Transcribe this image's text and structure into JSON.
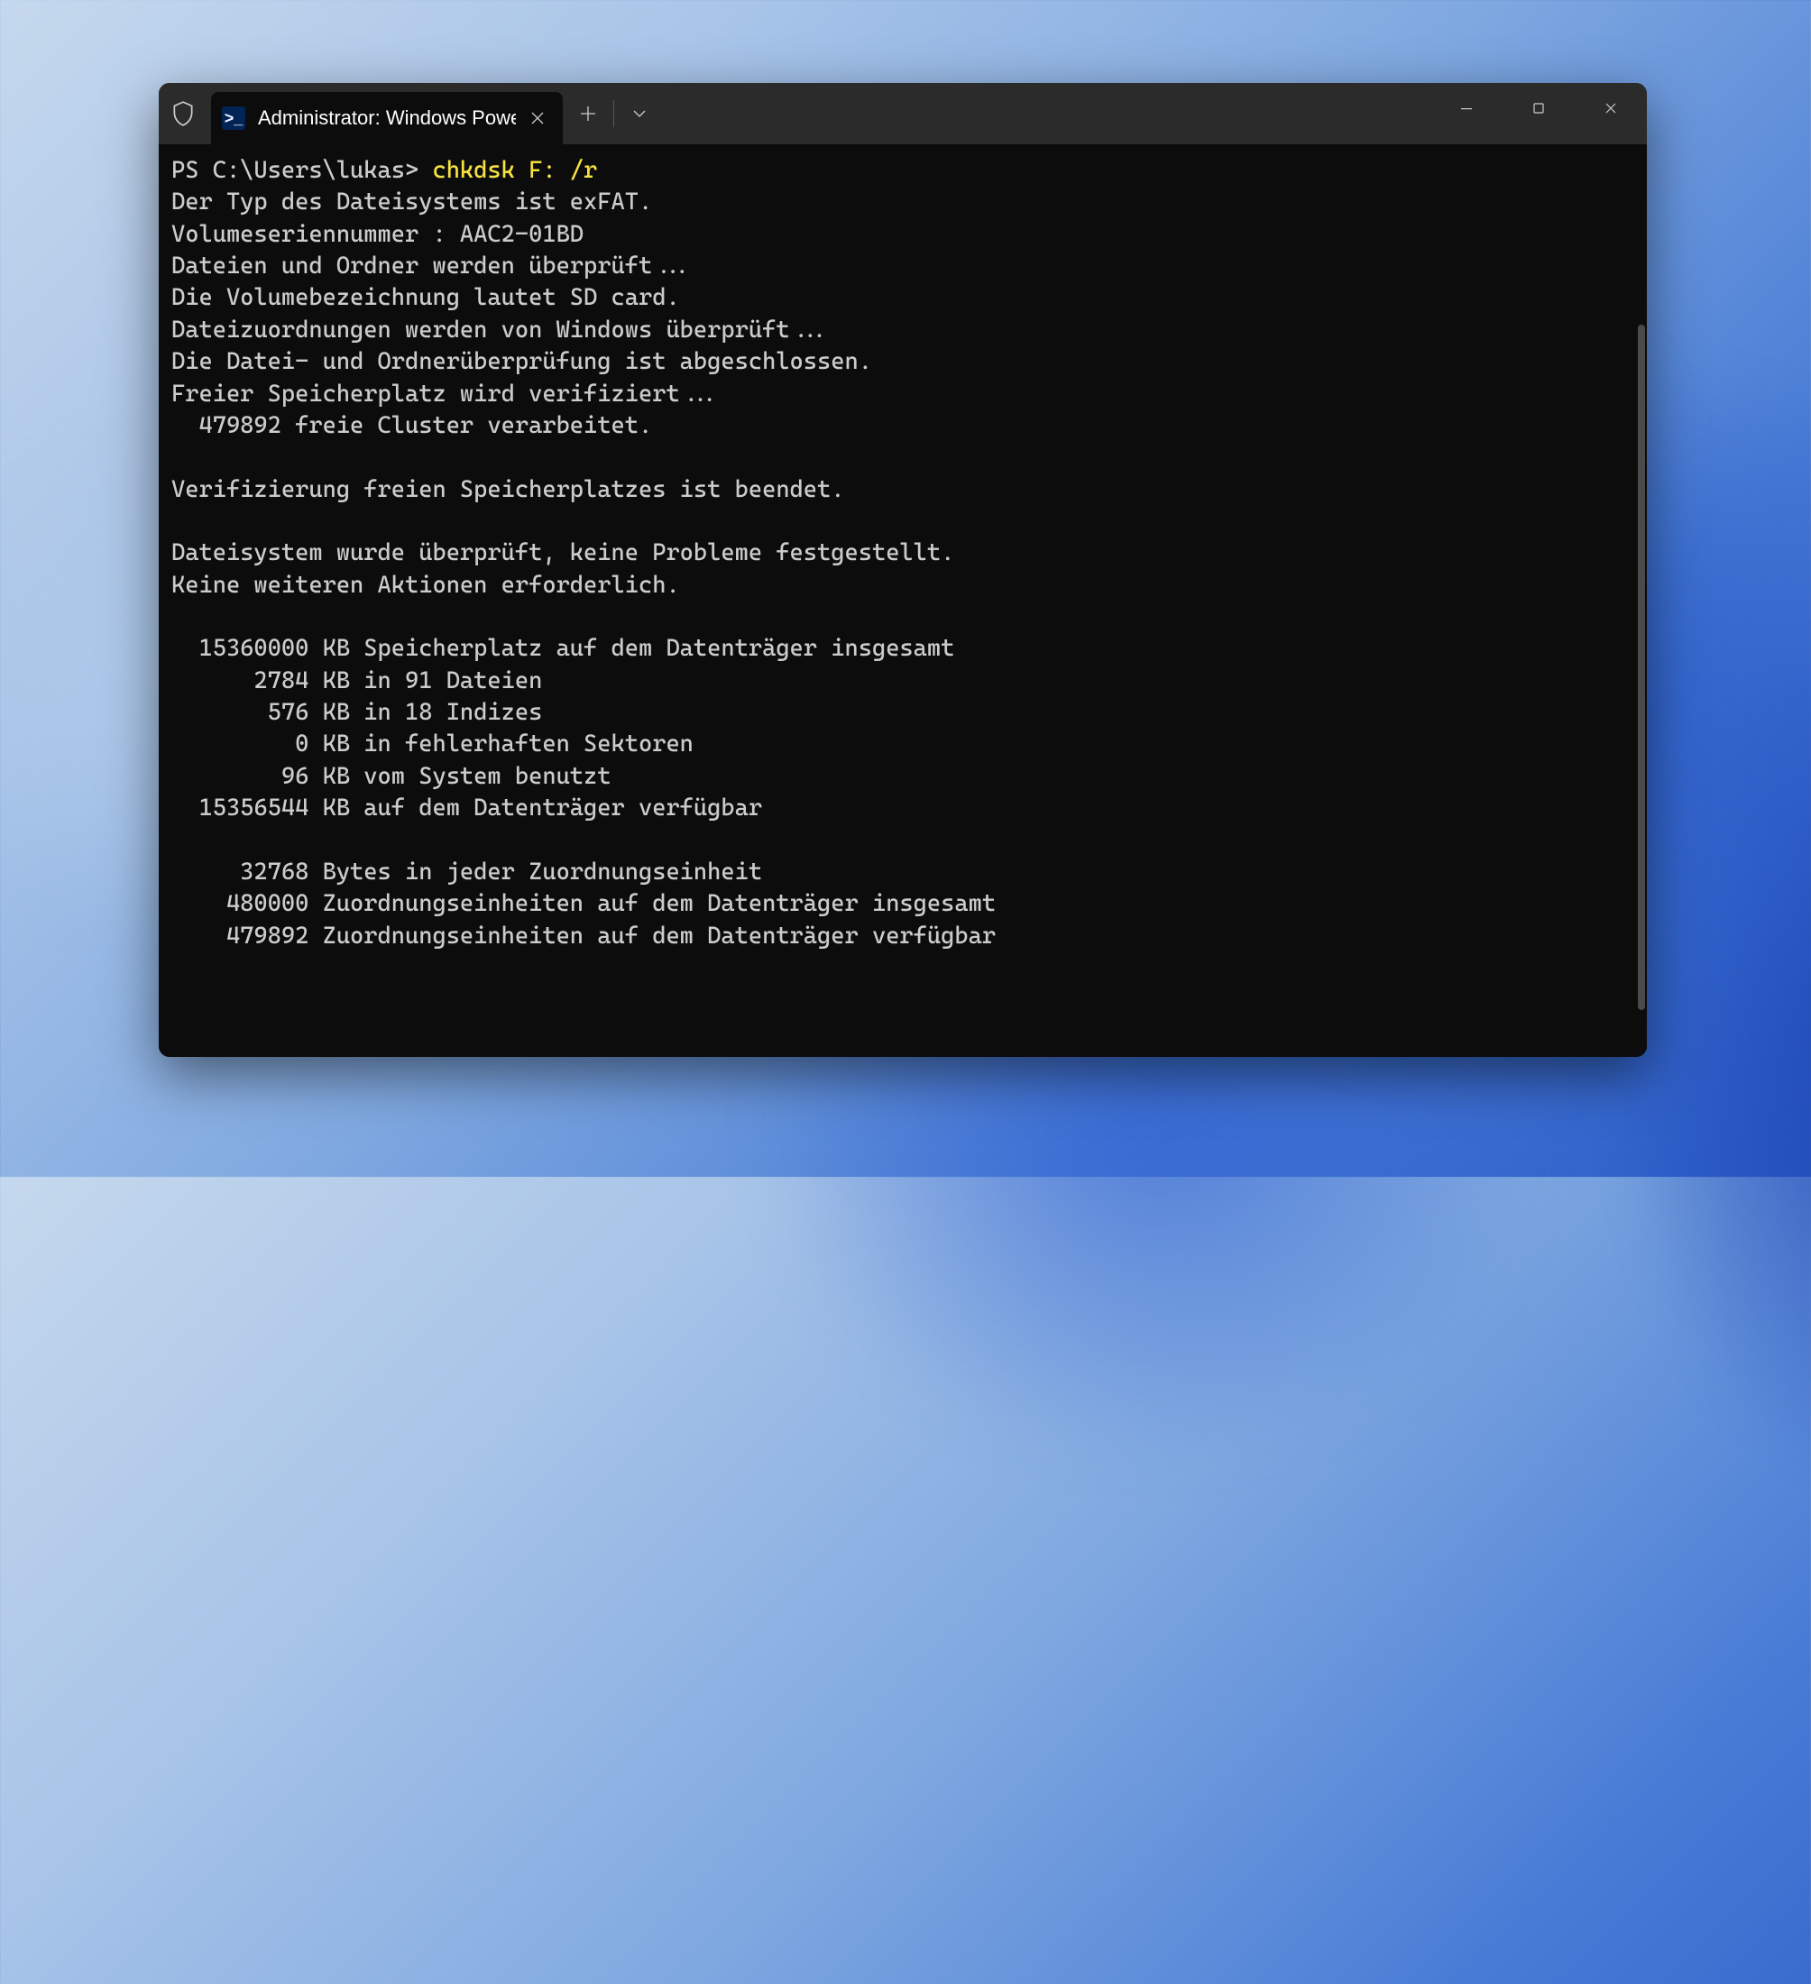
{
  "titlebar": {
    "tab_title": "Administrator: Windows Powe",
    "tab_close_label": "✕",
    "new_tab_label": "+",
    "dropdown_label": "⌄"
  },
  "terminal": {
    "prompt": "PS C:\\Users\\lukas> ",
    "command": "chkdsk F: /r",
    "output_lines": [
      "Der Typ des Dateisystems ist exFAT.",
      "Volumeseriennummer : AAC2-01BD",
      "Dateien und Ordner werden überprüft...",
      "Die Volumebezeichnung lautet SD card.",
      "Dateizuordnungen werden von Windows überprüft...",
      "Die Datei- und Ordnerüberprüfung ist abgeschlossen.",
      "Freier Speicherplatz wird verifiziert...",
      "  479892 freie Cluster verarbeitet.",
      "",
      "Verifizierung freien Speicherplatzes ist beendet.",
      "",
      "Dateisystem wurde überprüft, keine Probleme festgestellt.",
      "Keine weiteren Aktionen erforderlich.",
      "",
      "  15360000 KB Speicherplatz auf dem Datenträger insgesamt",
      "      2784 KB in 91 Dateien",
      "       576 KB in 18 Indizes",
      "         0 KB in fehlerhaften Sektoren",
      "        96 KB vom System benutzt",
      "  15356544 KB auf dem Datenträger verfügbar",
      "",
      "     32768 Bytes in jeder Zuordnungseinheit",
      "    480000 Zuordnungseinheiten auf dem Datenträger insgesamt",
      "    479892 Zuordnungseinheiten auf dem Datenträger verfügbar"
    ]
  }
}
